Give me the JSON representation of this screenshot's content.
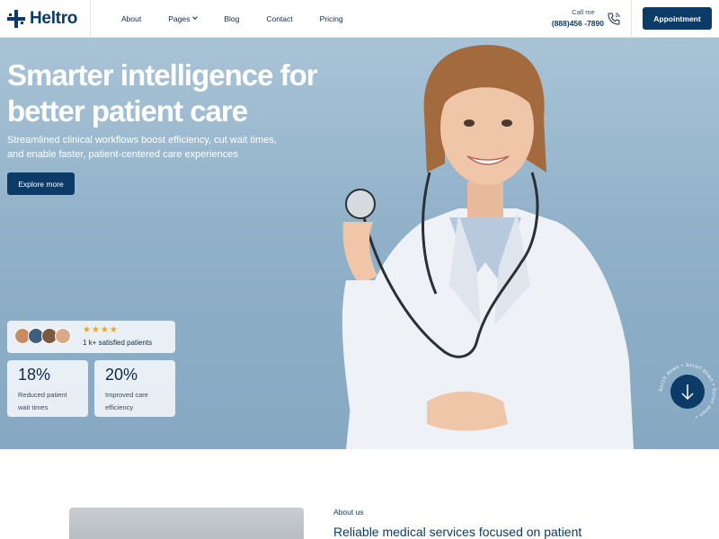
{
  "brand": {
    "name": "Heltro"
  },
  "nav": {
    "items": [
      {
        "label": "About"
      },
      {
        "label": "Pages"
      },
      {
        "label": "Blog"
      },
      {
        "label": "Contact"
      },
      {
        "label": "Pricing"
      }
    ]
  },
  "contact": {
    "call_label": "Call me",
    "phone": "(888)456 -7890"
  },
  "header": {
    "appointment_label": "Appointment"
  },
  "hero": {
    "title": "Smarter intelligence for better patient care",
    "subtitle": "Streamlined clinical workflows boost efficiency, cut wait times, and enable faster, patient-centered care experiences",
    "cta_label": "Explore more"
  },
  "satisfaction": {
    "stars": "★★★★",
    "text": "1 k+ satisfied patients"
  },
  "stats": [
    {
      "value": "18%",
      "label": "Reduced patient wait times"
    },
    {
      "value": "20%",
      "label": "Improved care efficiency"
    }
  ],
  "scroll": {
    "ring_text": "Scroll down • Scroll down • Scroll down •"
  },
  "about": {
    "tag": "About us",
    "title": "Reliable medical services focused on patient"
  },
  "colors": {
    "primary": "#0b3b66",
    "hero_bg": "#8fb0c8",
    "star": "#f4a11d"
  }
}
